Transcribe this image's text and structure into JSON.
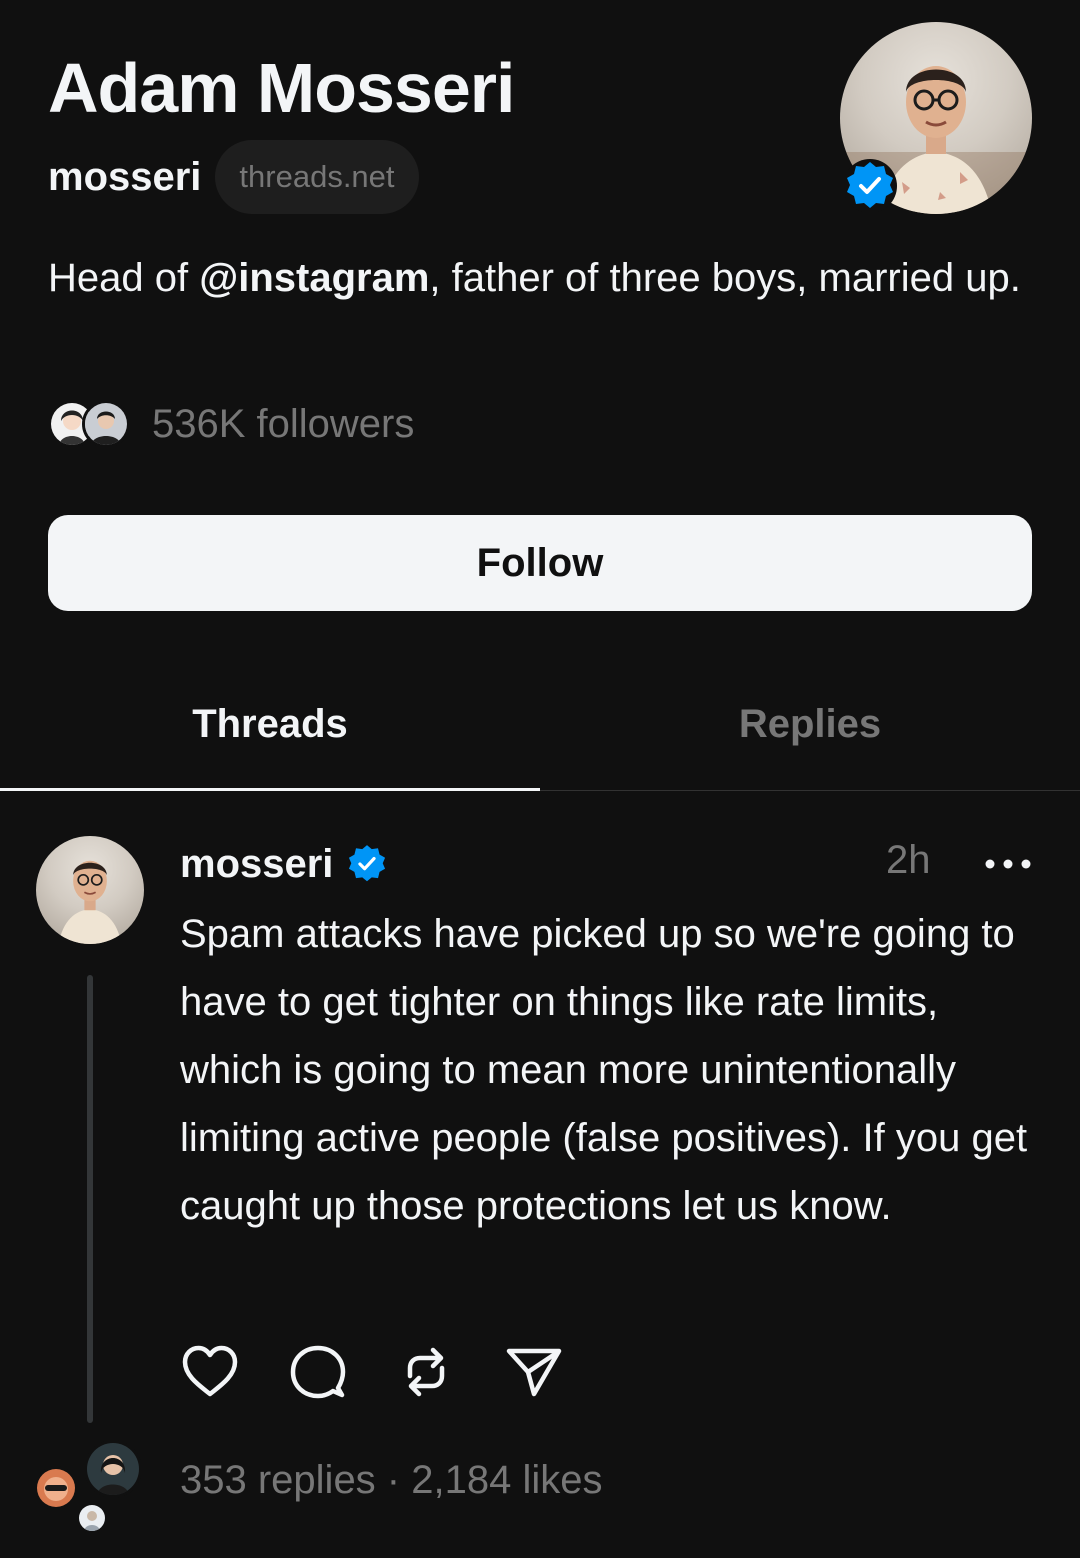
{
  "profile": {
    "name": "Adam Mosseri",
    "username": "mosseri",
    "domain": "threads.net",
    "bio_prefix": "Head of ",
    "bio_mention": "@instagram",
    "bio_suffix": ", father of three boys, married up.",
    "followers": "536K followers",
    "follow_button": "Follow"
  },
  "tabs": [
    {
      "label": "Threads",
      "active": true
    },
    {
      "label": "Replies",
      "active": false
    }
  ],
  "post": {
    "username": "mosseri",
    "time": "2h",
    "text": "Spam attacks have picked up so we're going to have to get tighter on things like rate limits, which is going to mean more unintentionally limiting active people (false positives). If you get caught up those protections let us know.",
    "stats": "353 replies · 2,184 likes"
  },
  "icons": {
    "verified": "verified-badge-icon",
    "more": "more-options-icon",
    "like": "heart-icon",
    "reply": "comment-bubble-icon",
    "repost": "repost-icon",
    "share": "send-icon"
  },
  "colors": {
    "background": "#101010",
    "text_primary": "#f3f5f7",
    "text_secondary": "#777777",
    "verified_blue": "#0095f6",
    "button_bg": "#f3f5f7"
  }
}
